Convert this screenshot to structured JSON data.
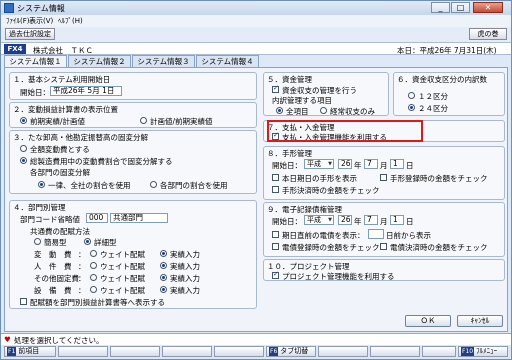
{
  "window": {
    "title": "システム情報"
  },
  "menu": [
    "ﾌｧｲﾙ(F)",
    "表示(V)",
    "ﾍﾙﾌﾟ(H)"
  ],
  "toolbar": {
    "past_settings": "過去仕訳設定",
    "tora_button": "虎の巻"
  },
  "company": {
    "code_badge": "FX4",
    "name": "株式会社　ＴＫＣ",
    "date": "本日：平成26年 7月31日(木)"
  },
  "tabs": [
    "システム情報１",
    "システム情報２",
    "システム情報３",
    "システム情報４"
  ],
  "sec1": {
    "title": "１．基本システム利用開始日",
    "start_label": "開始日：",
    "start_value": "平成26年 5月 1日"
  },
  "sec2": {
    "title": "２．変動損益計算書の表示位置",
    "opt1": "前期実績/計画値",
    "opt2": "計画値/前期実績値"
  },
  "sec3": {
    "title": "３．たな卸高・他勘定振替高の固変分解",
    "opt1": "全額変動費とする",
    "opt2": "総製造費用中の変動費割合で固変分解する",
    "sub_title": "各部門の固変分解",
    "sub1": "一律、全社の割合を使用",
    "sub2": "各部門の割合を使用"
  },
  "sec4": {
    "title": "４．部門別管理",
    "abbr_label": "部門コード省略値",
    "abbr_code": "000",
    "abbr_name": "共通部門",
    "alloc_title": "共通費の配賦方法",
    "simple": "簡易型",
    "detail": "詳細型",
    "rows": [
      {
        "label": "変　動　費",
        "a": "ウェイト配賦",
        "b": "実績入力"
      },
      {
        "label": "人　件　費",
        "a": "ウェイト配賦",
        "b": "実績入力"
      },
      {
        "label": "その他固定費",
        "a": "ウェイト配賦",
        "b": "実績入力"
      },
      {
        "label": "設　備　費",
        "a": "ウェイト配賦",
        "b": "実績入力"
      }
    ],
    "colon": "：",
    "footer_check": "配賦額を部門別損益計算書等へ表示する"
  },
  "sec5": {
    "title": "５．資金管理",
    "check": "資金収支の管理を行う",
    "sub_title": "内訳管理する項目",
    "opt1": "全項目",
    "opt2": "経常収支のみ"
  },
  "sec6": {
    "title": "６．資金収支区分の内訳数",
    "opt1": "１２区分",
    "opt2": "２４区分"
  },
  "sec7": {
    "title": "７．支払・入金管理",
    "check": "支払・入金管理機能を利用する"
  },
  "sec8": {
    "title": "８．手形管理",
    "start_label": "開始日：",
    "era": "平成",
    "year": "26",
    "year_unit": "年",
    "month": "7",
    "month_unit": "月",
    "day": "1",
    "day_unit": "日",
    "check1": "本日期日の手形を表示",
    "check2": "手形登録時の金額をチェック",
    "check3": "手形決済時の金額をチェック"
  },
  "sec9": {
    "title": "９．電子記録債権管理",
    "start_label": "開始日：",
    "era": "平成",
    "year": "26",
    "year_unit": "年",
    "month": "7",
    "month_unit": "月",
    "day": "1",
    "day_unit": "日",
    "check1": "期日直前の電債を表示：",
    "days_suffix": "日前から表示",
    "check2": "電債登録時の金額をチェック",
    "check3": "電債決済時の金額をチェック"
  },
  "sec10": {
    "title": "１０．プロジェクト管理",
    "check": "プロジェクト管理機能を利用する"
  },
  "buttons": {
    "ok": "ＯＫ",
    "cancel": "ｷｬﾝｾﾙ"
  },
  "status": "処理を選択してください。",
  "fkeys": {
    "f1": "前項目",
    "f6": "タブ切替",
    "f10": "ﾌﾙﾒﾆｭｰ",
    "f1_key": "F1",
    "f6_key": "F6",
    "f10_key": "F10"
  },
  "colors": {
    "title_badge": "#1f3d8a",
    "highlight": "#e01818"
  }
}
